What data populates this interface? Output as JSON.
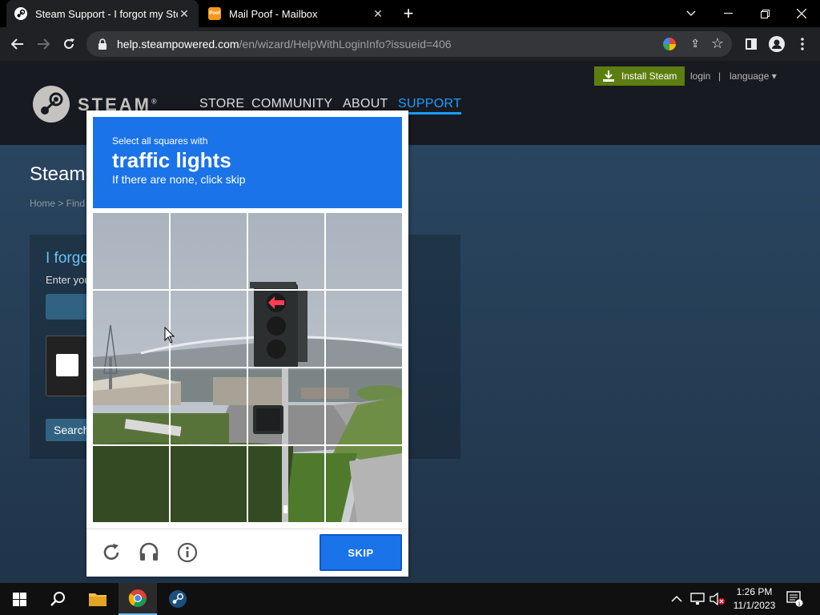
{
  "browser": {
    "tabs": [
      {
        "title": "Steam Support - I forgot my Ste",
        "active": true,
        "favicon": "steam-icon"
      },
      {
        "title": "Mail Poof - Mailbox",
        "active": false,
        "favicon": "mailpoof-icon"
      }
    ],
    "new_tab": "+",
    "url_host": "help.steampowered.com",
    "url_path": "/en/wizard/HelpWithLoginInfo?issueid=406"
  },
  "steam": {
    "install_label": "Install Steam",
    "login_label": "login",
    "separator": "|",
    "language_label": "language ▾",
    "logo_text": "STEAM",
    "logo_reg": "®",
    "nav": [
      "STORE",
      "COMMUNITY",
      "ABOUT",
      "SUPPORT"
    ],
    "heading": "Steam",
    "breadcrumb": "Home > Find",
    "forgot_title": "I forgo",
    "forgot_enter": "Enter you",
    "search_label": "Search"
  },
  "captcha": {
    "prompt_small": "Select all squares with",
    "prompt_target": "traffic lights",
    "prompt_hint": "If there are none, click skip",
    "skip_label": "SKIP",
    "grid_rows": 4,
    "grid_cols": 4
  },
  "taskbar": {
    "time": "1:26 PM",
    "date": "11/1/2023"
  },
  "colors": {
    "captcha_blue": "#1a73e8",
    "steam_support_blue": "#1a9fff",
    "install_green": "#5c7e10"
  }
}
